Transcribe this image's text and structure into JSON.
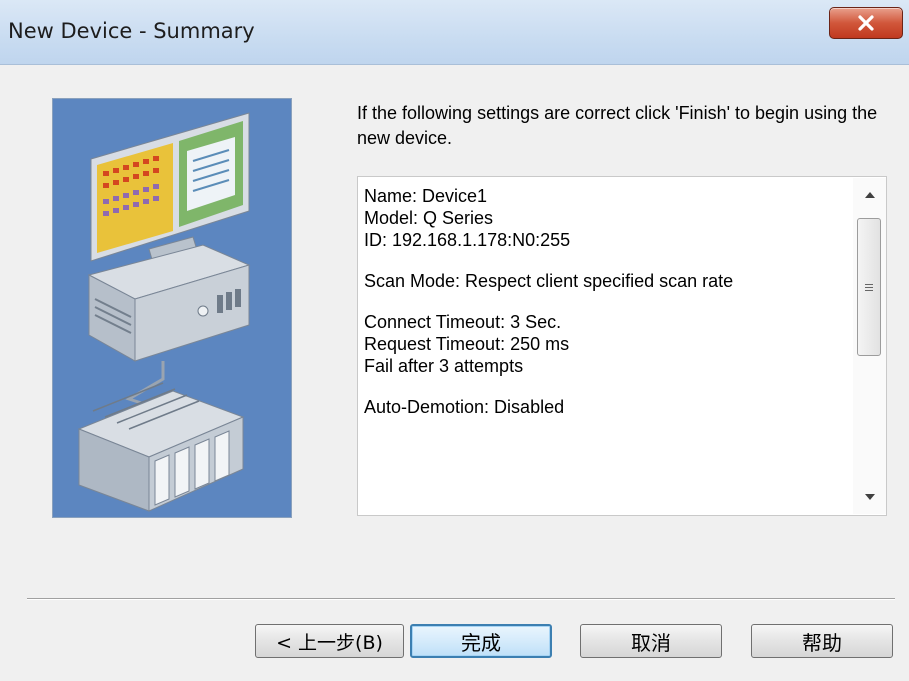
{
  "window": {
    "title": "New Device - Summary",
    "close_icon": "close-icon"
  },
  "instruction": "If the following settings are correct click 'Finish' to begin using the new device.",
  "summary": {
    "lines": [
      "Name: Device1",
      "Model: Q Series",
      "ID: 192.168.1.178:N0:255",
      "",
      "Scan Mode: Respect client specified scan rate",
      "",
      "Connect Timeout: 3 Sec.",
      "Request Timeout: 250 ms",
      "Fail after 3 attempts",
      "",
      "Auto-Demotion: Disabled"
    ]
  },
  "buttons": {
    "back": "< 上一步(B)",
    "finish": "完成",
    "cancel": "取消",
    "help": "帮助"
  },
  "colors": {
    "illustration_bg": "#5c86c0",
    "default_button_border": "#3c7fb1",
    "close_button": "#c9452b"
  }
}
